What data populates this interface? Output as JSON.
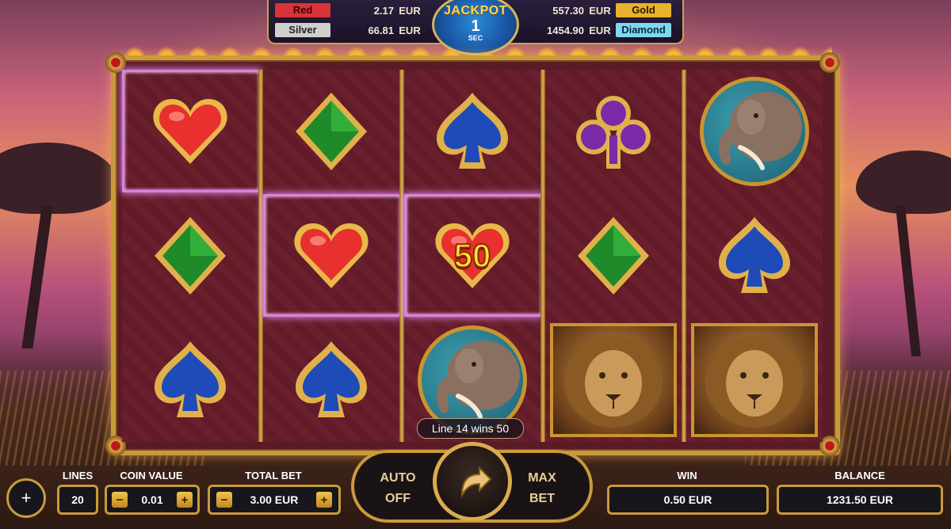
{
  "jackpots": {
    "red": {
      "label": "Red",
      "value": "2.17",
      "currency": "EUR",
      "color": "#d9343a"
    },
    "silver": {
      "label": "Silver",
      "value": "66.81",
      "currency": "EUR",
      "color": "#c9c9c9"
    },
    "gold": {
      "label": "Gold",
      "value": "557.30",
      "currency": "EUR",
      "color": "#e8b22a"
    },
    "diamond": {
      "label": "Diamond",
      "value": "1454.90",
      "currency": "EUR",
      "color": "#7ed8ee"
    },
    "badge": {
      "title": "JACKPOT",
      "number": "1",
      "unit": "SEC"
    }
  },
  "reels": {
    "columns": [
      [
        "heart",
        "diamond",
        "spade"
      ],
      [
        "diamond",
        "heart",
        "spade"
      ],
      [
        "spade",
        "heart",
        "elephant"
      ],
      [
        "club",
        "diamond",
        "lion"
      ],
      [
        "elephant",
        "spade",
        "lion"
      ]
    ],
    "highlighted_cells": [
      "r1c1",
      "r2c2",
      "r2c3"
    ],
    "win_amount_overlay": "50",
    "line_win_text": "Line 14 wins 50"
  },
  "controls": {
    "lines": {
      "label": "LINES",
      "value": "20"
    },
    "coin_value": {
      "label": "COIN VALUE",
      "value": "0.01",
      "minus": "−",
      "plus": "+"
    },
    "total_bet": {
      "label": "TOTAL BET",
      "value": "3.00 EUR",
      "minus": "−",
      "plus": "+"
    },
    "auto": {
      "line1": "AUTO",
      "line2": "OFF"
    },
    "max_bet": {
      "line1": "MAX",
      "line2": "BET"
    },
    "win": {
      "label": "WIN",
      "value": "0.50 EUR"
    },
    "balance": {
      "label": "BALANCE",
      "value": "1231.50 EUR"
    },
    "menu": "+"
  },
  "icons": {
    "spin": "spin-arrow-icon",
    "heart": "heart-icon",
    "diamond": "diamond-icon",
    "spade": "spade-icon",
    "club": "club-icon",
    "elephant": "elephant-icon",
    "lion": "lion-icon"
  }
}
